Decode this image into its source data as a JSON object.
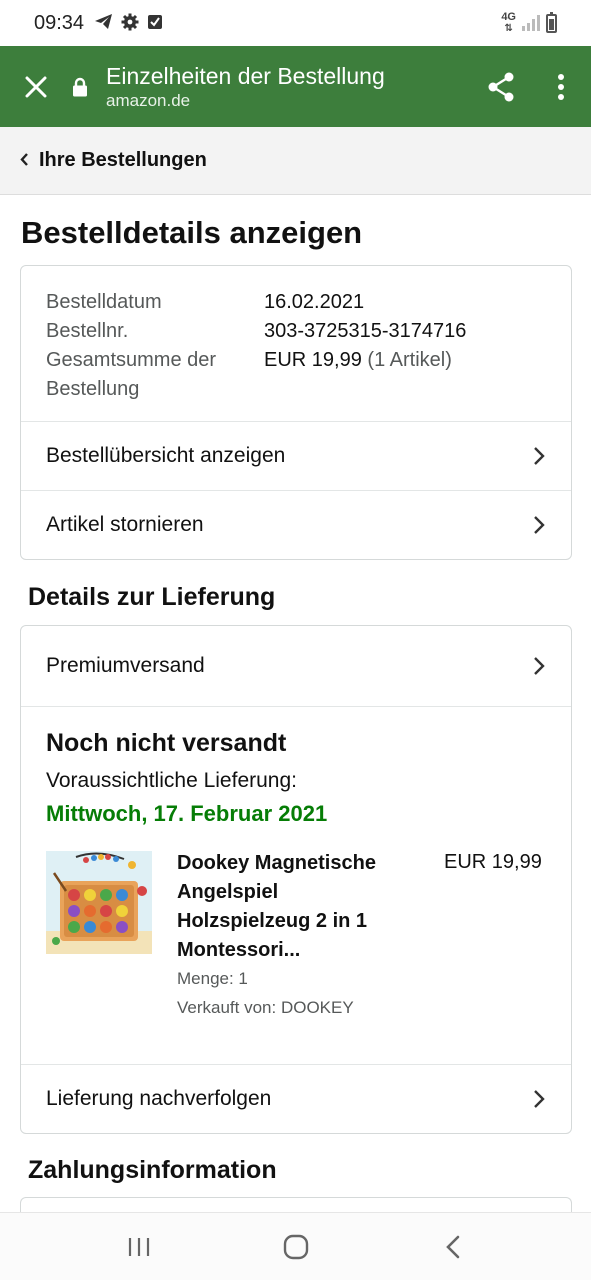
{
  "status_bar": {
    "time": "09:34",
    "network_label": "4G",
    "icons": [
      "telegram-icon",
      "settings-icon",
      "checkbox-notification-icon",
      "signal-icon",
      "battery-icon"
    ]
  },
  "browser": {
    "title": "Einzelheiten der Bestellung",
    "url": "amazon.de",
    "accent_color": "#3d7e3c"
  },
  "breadcrumb": {
    "label": "Ihre Bestellungen"
  },
  "page": {
    "title": "Bestelldetails anzeigen"
  },
  "order_summary": {
    "rows": [
      {
        "label": "Bestelldatum",
        "value": "16.02.2021"
      },
      {
        "label": "Bestellnr.",
        "value": "303-3725315-3174716"
      }
    ],
    "total_label_line1": "Gesamtsumme der",
    "total_label_line2": "Bestellung",
    "total_value": "EUR 19,99",
    "total_items": "(1 Artikel)",
    "links": [
      {
        "label": "Bestellübersicht anzeigen"
      },
      {
        "label": "Artikel stornieren"
      }
    ]
  },
  "delivery": {
    "section_title": "Details zur Lieferung",
    "shipping_method": "Premiumversand",
    "status": "Noch nicht versandt",
    "eta_label": "Voraussichtliche Lieferung:",
    "eta_date": "Mittwoch, 17. Februar 2021",
    "eta_color": "#067d06",
    "product": {
      "title": "Dookey Magnetische Angelspiel Holzspielzeug 2 in 1 Montessori...",
      "price": "EUR 19,99",
      "quantity": "Menge: 1",
      "seller": "Verkauft von: DOOKEY"
    },
    "track_label": "Lieferung nachverfolgen"
  },
  "payment": {
    "section_title": "Zahlungsinformation"
  },
  "nav_bar": {
    "buttons": [
      "recent-apps-icon",
      "home-icon",
      "back-icon"
    ]
  }
}
